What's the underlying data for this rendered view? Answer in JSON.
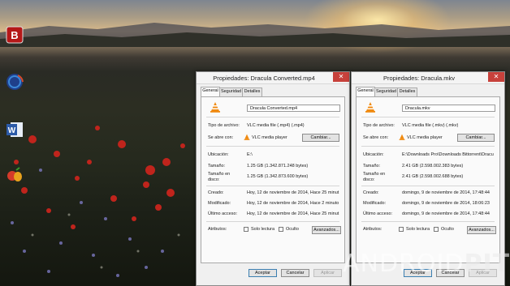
{
  "desktop": {
    "icons": [
      "bitdefender-icon",
      "globe-icon",
      "word-icon",
      "fruit-app-icon"
    ],
    "accent": "#c7413b"
  },
  "windows": [
    {
      "title": "Propiedades: Dracula Converted.mp4",
      "tabs": [
        "General",
        "Seguridad",
        "Detalles"
      ],
      "filename": "Dracula Converted.mp4",
      "rows": {
        "type_label": "Tipo de archivo:",
        "type_value": "VLC media file (.mp4) (.mp4)",
        "opens_label": "Se abre con:",
        "opens_value": "VLC media player",
        "change_button": "Cambiar...",
        "location_label": "Ubicación:",
        "location_value": "E:\\",
        "size_label": "Tamaño:",
        "size_value": "1.25 GB (1.342.871.248 bytes)",
        "disk_label_1": "Tamaño en",
        "disk_label_2": "disco:",
        "disk_value": "1.25 GB (1.342.873.600 bytes)",
        "created_label": "Creado:",
        "created_value": "Hoy, 12 de noviembre de 2014, Hace 25 minut",
        "modified_label": "Modificado:",
        "modified_value": "Hoy, 12 de noviembre de 2014, Hace 2 minuto",
        "accessed_label": "Último acceso:",
        "accessed_value": "Hoy, 12 de noviembre de 2014, Hace 25 minut",
        "attributes_label": "Atributos:",
        "readonly_label": "Solo lectura",
        "hidden_label": "Oculto",
        "advanced_button": "Avanzados..."
      },
      "footer": {
        "ok": "Aceptar",
        "cancel": "Cancelar",
        "apply": "Aplicar"
      }
    },
    {
      "title": "Propiedades: Dracula.mkv",
      "tabs": [
        "General",
        "Seguridad",
        "Detalles"
      ],
      "filename": "Dracula.mkv",
      "rows": {
        "type_label": "Tipo de archivo:",
        "type_value": "VLC media file (.mkv) (.mkv)",
        "opens_label": "Se abre con:",
        "opens_value": "VLC media player",
        "change_button": "Cambiar...",
        "location_label": "Ubicación:",
        "location_value": "E:\\Downloads Pro\\Downloads Bittorrent\\Dracu",
        "size_label": "Tamaño:",
        "size_value": "2.41 GB (2.598.002.383 bytes)",
        "disk_label_1": "Tamaño en",
        "disk_label_2": "disco:",
        "disk_value": "2.41 GB (2.598.002.688 bytes)",
        "created_label": "Creado:",
        "created_value": "domingo, 9 de noviembre de 2014, 17:48:44",
        "modified_label": "Modificado:",
        "modified_value": "domingo, 9 de noviembre de 2014, 18:06:23",
        "accessed_label": "Último acceso:",
        "accessed_value": "domingo, 9 de noviembre de 2014, 17:48:44",
        "attributes_label": "Atributos:",
        "readonly_label": "Solo lectura",
        "hidden_label": "Oculto",
        "advanced_button": "Avanzados..."
      },
      "footer": {
        "ok": "Aceptar",
        "cancel": "Cancelar",
        "apply": "Aplicar"
      }
    }
  ],
  "watermark": {
    "part1": "ANDROID",
    "part2": "PIT"
  }
}
